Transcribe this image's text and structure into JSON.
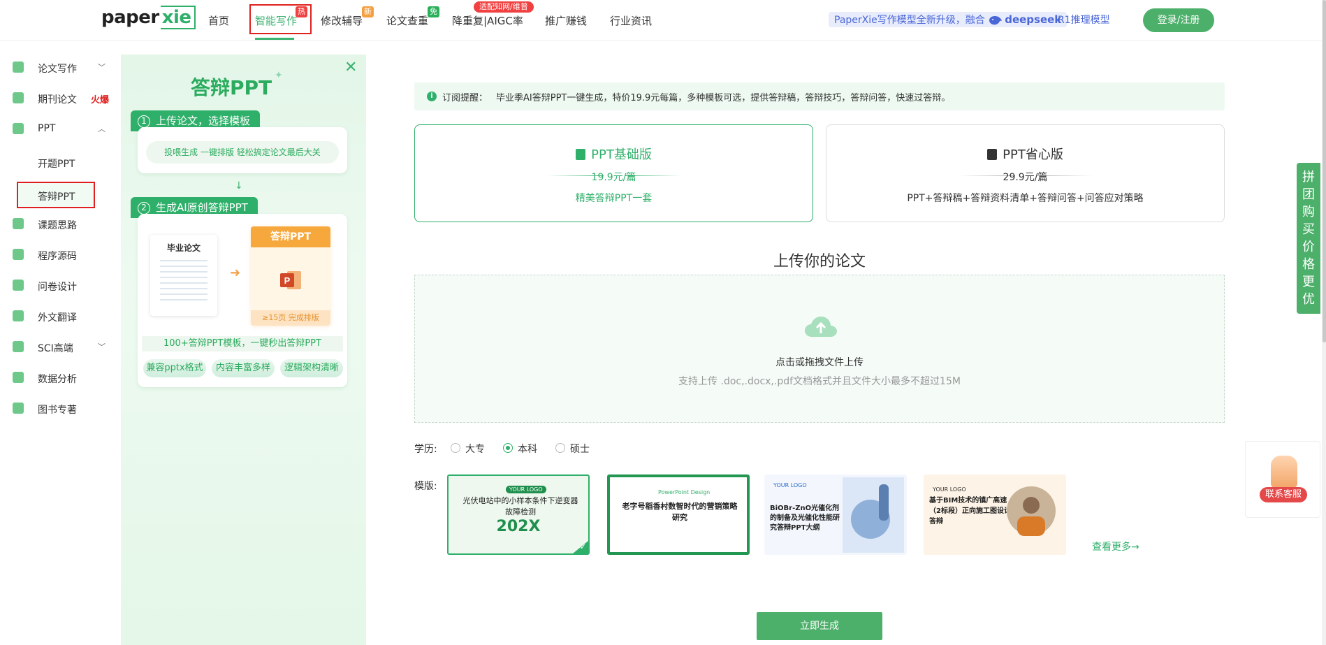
{
  "nav": {
    "logo_main": "paper",
    "logo_accent": "xie",
    "items": [
      {
        "label": "首页"
      },
      {
        "label": "智能写作",
        "badge": "热"
      },
      {
        "label": "修改辅导",
        "badge": "新"
      },
      {
        "label": "论文查重",
        "badge": "免"
      },
      {
        "label": "降重复|AIGC率",
        "badge": "适配知网/维普"
      },
      {
        "label": "推广赚钱"
      },
      {
        "label": "行业资讯"
      }
    ],
    "promo_text": "PaperXie写作模型全新升级，融合",
    "promo_brand": "deepseek",
    "promo_tail": "R1推理模型",
    "login_label": "登录/注册"
  },
  "sidebar": {
    "items": [
      {
        "label": "论文写作",
        "icon": "pen-icon"
      },
      {
        "label": "期刊论文",
        "icon": "journal-icon",
        "tag": "火爆"
      },
      {
        "label": "PPT",
        "icon": "ppt-icon"
      },
      {
        "label": "开题PPT"
      },
      {
        "label": "答辩PPT"
      },
      {
        "label": "课题思路",
        "icon": "idea-icon"
      },
      {
        "label": "程序源码",
        "icon": "code-icon"
      },
      {
        "label": "问卷设计",
        "icon": "survey-icon"
      },
      {
        "label": "外文翻译",
        "icon": "translate-icon"
      },
      {
        "label": "SCI高端",
        "icon": "sci-icon"
      },
      {
        "label": "数据分析",
        "icon": "chart-icon"
      },
      {
        "label": "图书专著",
        "icon": "book-icon"
      }
    ]
  },
  "intro": {
    "title": "答辩PPT",
    "step1_num": "1",
    "step1": "上传论文，选择模板",
    "step1_pill": "投喂生成  一键排版  轻松搞定论文最后大关",
    "step2_num": "2",
    "step2": "生成AI原创答辩PPT",
    "paper_label": "毕业论文",
    "ppt_label": "答辩PPT",
    "ppt_footer": "≥15页 完成排版",
    "templates_line": "100+答辩PPT模板，一键秒出答辩PPT",
    "features": [
      "兼容pptx格式",
      "内容丰富多样",
      "逻辑架构清晰"
    ]
  },
  "notice": {
    "label": "订阅提醒：",
    "text": "毕业季AI答辩PPT一键生成，特价19.9元每篇，多种模板可选，提供答辩稿，答辩技巧，答辩问答，快速过答辩。"
  },
  "plans": [
    {
      "title": "PPT基础版",
      "price": "19.9元/篇",
      "desc": "精美答辩PPT一套"
    },
    {
      "title": "PPT省心版",
      "price": "29.9元/篇",
      "desc": "PPT+答辩稿+答辩资料清单+答辩问答+问答应对策略"
    }
  ],
  "upload": {
    "title": "上传你的论文",
    "main": "点击或拖拽文件上传",
    "sub": "支持上传 .doc,.docx,.pdf文档格式并且文件大小最多不超过15M"
  },
  "education": {
    "label": "学历:",
    "options": [
      "大专",
      "本科",
      "硕士"
    ],
    "selected": "本科"
  },
  "templates": {
    "label": "模版:",
    "items": [
      {
        "logo": "YOUR LOGO",
        "title": "光伏电站中的小样本条件下逆变器故障检测",
        "year": "202X"
      },
      {
        "logo": "PowerPoint Design",
        "title": "老字号稻香村数智时代的营销策略研究"
      },
      {
        "logo": "YOUR LOGO",
        "title": "BiOBr-ZnO光催化剂的制备及光催化性能研究答辩PPT大纲"
      },
      {
        "logo": "YOUR LOGO",
        "title": "基于BIM技术的镇广高速（2标段）正向施工图设计答辩"
      }
    ],
    "more": "查看更多→"
  },
  "generate_label": "立即生成",
  "group_buy": "拼团购买 价格更优",
  "service_label": "联系客服",
  "colors": {
    "brand_green": "#2fb06a",
    "hot_red": "#e02020",
    "promo_blue": "#4a67d8"
  }
}
